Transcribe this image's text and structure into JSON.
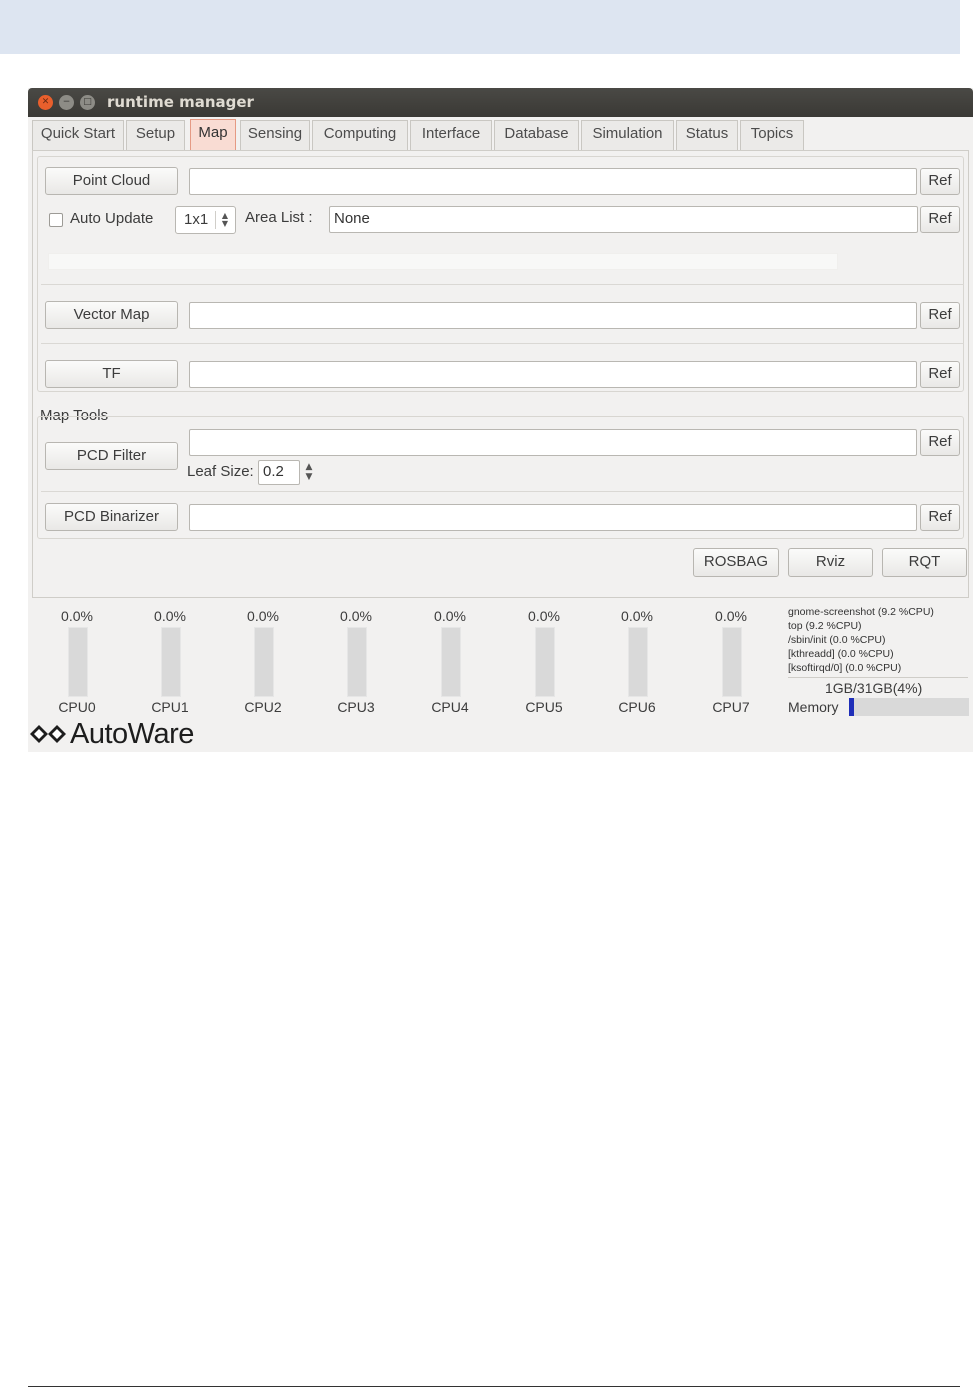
{
  "window": {
    "title": "runtime manager"
  },
  "tabs": [
    {
      "label": "Quick Start"
    },
    {
      "label": "Setup"
    },
    {
      "label": "Map",
      "active": true
    },
    {
      "label": "Sensing"
    },
    {
      "label": "Computing"
    },
    {
      "label": "Interface"
    },
    {
      "label": "Database"
    },
    {
      "label": "Simulation"
    },
    {
      "label": "Status"
    },
    {
      "label": "Topics"
    }
  ],
  "map": {
    "point_cloud": {
      "button": "Point Cloud",
      "path_value": "",
      "ref": "Ref"
    },
    "auto_update": {
      "label": "Auto Update",
      "checked": false
    },
    "grid_size": {
      "value": "1x1"
    },
    "area_list": {
      "label": "Area List :",
      "value": "None",
      "ref": "Ref"
    },
    "vector_map": {
      "button": "Vector Map",
      "path_value": "",
      "ref": "Ref"
    },
    "tf": {
      "button": "TF",
      "path_value": "",
      "ref": "Ref"
    },
    "map_tools": {
      "title": "Map Tools",
      "pcd_filter": {
        "button": "PCD Filter",
        "path_value": "",
        "ref": "Ref",
        "leaf_label": "Leaf Size:",
        "leaf_value": "0.2"
      },
      "pcd_binarizer": {
        "button": "PCD Binarizer",
        "path_value": "",
        "ref": "Ref"
      }
    }
  },
  "actions": {
    "rosbag": "ROSBAG",
    "rviz": "Rviz",
    "rqt": "RQT"
  },
  "cpus": [
    {
      "label": "CPU0",
      "usage": "0.0%"
    },
    {
      "label": "CPU1",
      "usage": "0.0%"
    },
    {
      "label": "CPU2",
      "usage": "0.0%"
    },
    {
      "label": "CPU3",
      "usage": "0.0%"
    },
    {
      "label": "CPU4",
      "usage": "0.0%"
    },
    {
      "label": "CPU5",
      "usage": "0.0%"
    },
    {
      "label": "CPU6",
      "usage": "0.0%"
    },
    {
      "label": "CPU7",
      "usage": "0.0%"
    }
  ],
  "processes": [
    "gnome-screenshot (9.2 %CPU)",
    "top (9.2 %CPU)",
    "/sbin/init (0.0 %CPU)",
    "[kthreadd] (0.0 %CPU)",
    "[ksoftirqd/0] (0.0 %CPU)"
  ],
  "memory": {
    "label": "Memory",
    "text": "1GB/31GB(4%)",
    "fraction": 0.04
  },
  "brand": {
    "name": "AutoWare",
    "color": "#1d1d1d"
  },
  "colors": {
    "active_tab": "#f9dcd3",
    "memory_bar": "#1f2eb8",
    "close_button": "#e95f2c"
  }
}
